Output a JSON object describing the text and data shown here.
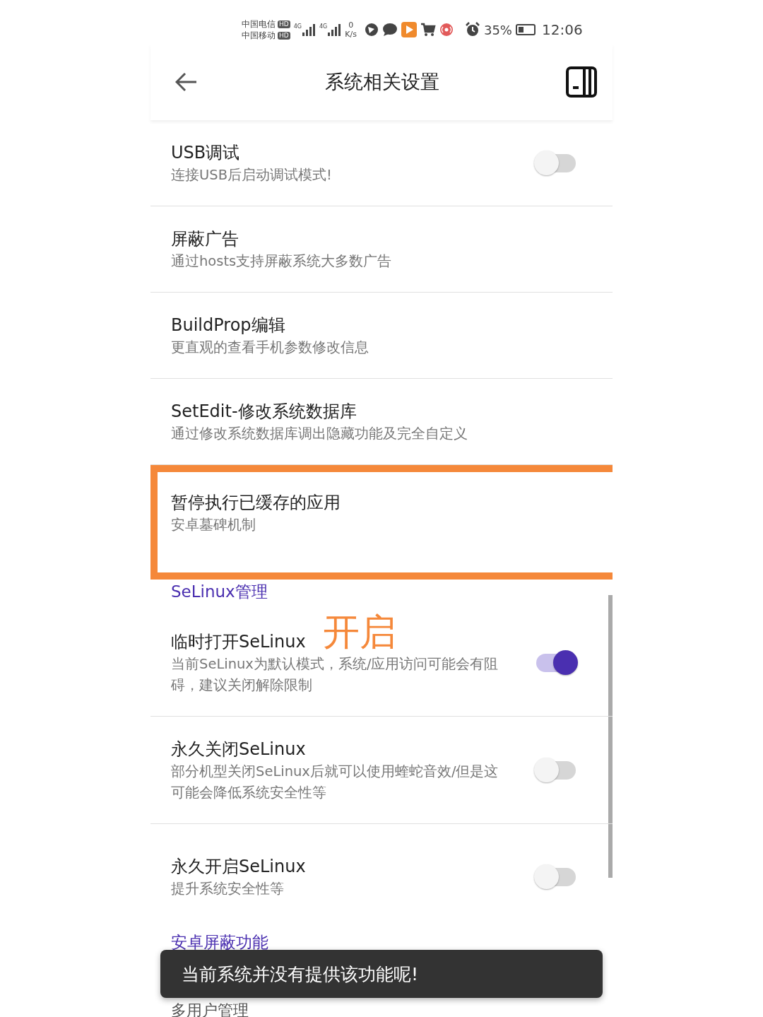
{
  "status_bar": {
    "carriers": [
      {
        "name": "中国电信",
        "badge": "HD"
      },
      {
        "name": "中国移动",
        "badge": "HD"
      }
    ],
    "network": [
      "4G",
      "4G"
    ],
    "speed": {
      "value": "0",
      "unit": "K/s"
    },
    "battery": {
      "percent": "35%",
      "level": 0.35
    },
    "time": "12:06"
  },
  "header": {
    "title": "系统相关设置"
  },
  "sections": [
    {
      "items": [
        {
          "kind": "switch",
          "title": "USB调试",
          "subtitle": "连接USB后启动调试模式!",
          "on": false
        },
        {
          "kind": "plain",
          "title": "屏蔽广告",
          "subtitle": "通过hosts支持屏蔽系统大多数广告"
        },
        {
          "kind": "plain",
          "title": "BuildProp编辑",
          "subtitle": "更直观的查看手机参数修改信息"
        },
        {
          "kind": "plain",
          "title": "SetEdit-修改系统数据库",
          "subtitle": "通过修改系统数据库调出隐藏功能及完全自定义"
        },
        {
          "kind": "plain",
          "title": "暂停执行已缓存的应用",
          "subtitle": "安卓墓碑机制",
          "highlighted": true
        }
      ]
    },
    {
      "header": "SeLinux管理",
      "items": [
        {
          "kind": "switch",
          "title": "临时打开SeLinux",
          "subtitle": "当前SeLinux为默认模式，系统/应用访问可能会有阻碍，建议关闭解除限制",
          "on": true,
          "annotation": "开启"
        },
        {
          "kind": "switch",
          "title": "永久关闭SeLinux",
          "subtitle": "部分机型关闭SeLinux后就可以使用蝰蛇音效/但是这可能会降低系统安全性等",
          "on": false
        },
        {
          "kind": "switch",
          "title": "永久开启SeLinux",
          "subtitle": "提升系统安全性等",
          "on": false
        }
      ]
    },
    {
      "header": "安卓屏蔽功能",
      "items": [
        {
          "kind": "plain",
          "title": "多用户管理"
        }
      ]
    }
  ],
  "toast": {
    "message": "当前系统并没有提供该功能呢!"
  }
}
